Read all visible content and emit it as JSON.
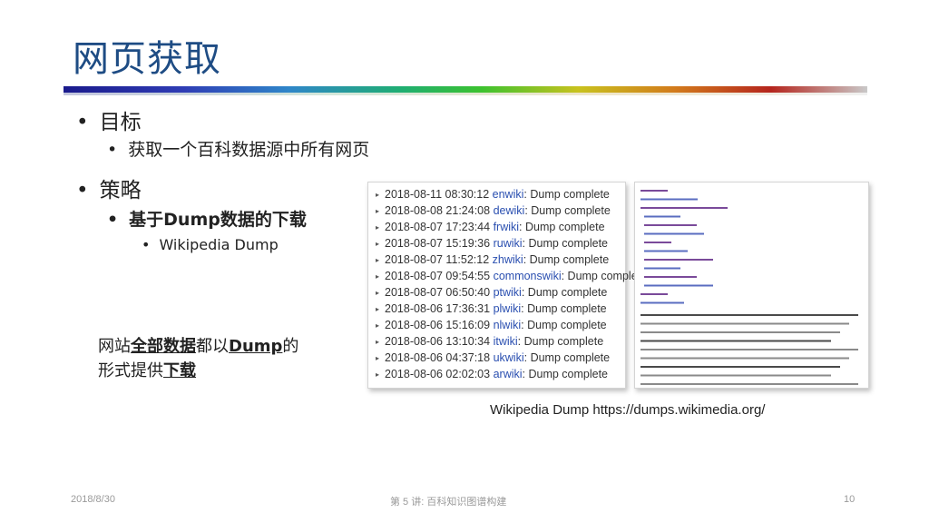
{
  "slide": {
    "title": "网页获取",
    "bullets": [
      {
        "level": 1,
        "text": "目标"
      },
      {
        "level": 2,
        "text": "获取一个百科数据源中所有网页"
      },
      {
        "level": 1,
        "text": "策略"
      },
      {
        "level": 2,
        "text": "基于Dump数据的下载"
      },
      {
        "level": 3,
        "text": "Wikipedia Dump"
      }
    ],
    "bullet_symbol": "•",
    "note": {
      "line1_a": "网站",
      "line1_b": "全部数据",
      "line1_c": "都以",
      "line1_d": "Dump",
      "line1_e": "的",
      "line2_a": "形式提供",
      "line2_b": "下载"
    },
    "dumps": [
      {
        "time": "2018-08-11 08:30:12",
        "wiki": "enwiki",
        "status": ": Dump complete"
      },
      {
        "time": "2018-08-08 21:24:08",
        "wiki": "dewiki",
        "status": ": Dump complete"
      },
      {
        "time": "2018-08-07 17:23:44",
        "wiki": "frwiki",
        "status": ": Dump complete"
      },
      {
        "time": "2018-08-07 15:19:36",
        "wiki": "ruwiki",
        "status": ": Dump complete"
      },
      {
        "time": "2018-08-07 11:52:12",
        "wiki": "zhwiki",
        "status": ": Dump complete"
      },
      {
        "time": "2018-08-07 09:54:55",
        "wiki": "commonswiki",
        "status": ": Dump complete"
      },
      {
        "time": "2018-08-07 06:50:40",
        "wiki": "ptwiki",
        "status": ": Dump complete"
      },
      {
        "time": "2018-08-06 17:36:31",
        "wiki": "plwiki",
        "status": ": Dump complete"
      },
      {
        "time": "2018-08-06 15:16:09",
        "wiki": "nlwiki",
        "status": ": Dump complete"
      },
      {
        "time": "2018-08-06 13:10:34",
        "wiki": "itwiki",
        "status": ": Dump complete"
      },
      {
        "time": "2018-08-06 04:37:18",
        "wiki": "ukwiki",
        "status": ": Dump complete"
      },
      {
        "time": "2018-08-06 02:02:03",
        "wiki": "arwiki",
        "status": ": Dump complete"
      }
    ],
    "caption": "Wikipedia Dump https://dumps.wikimedia.org/",
    "footer": {
      "date": "2018/8/30",
      "lecture": "第 5 讲:  百科知识图谱构建",
      "page": "10"
    },
    "colors": {
      "title": "#1e4c84",
      "wiki_link": "#2a4fb0"
    }
  }
}
